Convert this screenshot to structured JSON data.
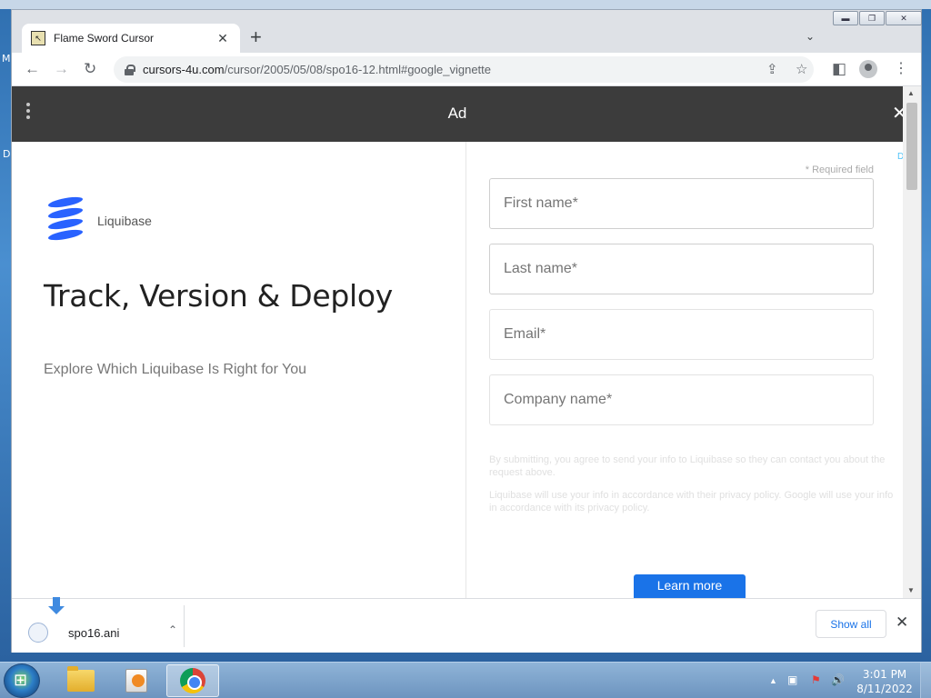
{
  "desktop": {
    "label_m": "M",
    "label_d": "D"
  },
  "tab": {
    "title": "Flame Sword Cursor",
    "close_glyph": "✕",
    "new_tab_glyph": "+"
  },
  "window_controls": {
    "minimize": "▬",
    "maximize": "❐",
    "close": "✕"
  },
  "toolbar": {
    "url_host": "cursors-4u.com",
    "url_path": "/cursor/2005/05/08/spo16-12.html#google_vignette",
    "back": "←",
    "forward": "→",
    "reload": "↻",
    "share": "⇪",
    "bookmark": "☆",
    "sidepanel": "◧",
    "menu": "⋮",
    "tab_search": "⌄"
  },
  "ad": {
    "bar_title": "Ad",
    "close_glyph": "✕",
    "brand": "Liquibase",
    "headline": "Track, Version & Deploy",
    "subhead": "Explore Which Liquibase Is Right for You",
    "required_note": "* Required field",
    "fields": {
      "first_name": "First name*",
      "last_name": "Last name*",
      "email": "Email*",
      "company": "Company name*"
    },
    "disclaimer_1": "By submitting, you agree to send your info to Liquibase so they can contact you about the request above.",
    "disclaimer_2": "Liquibase will use your info in accordance with their privacy policy. Google will use your info in accordance with its privacy policy.",
    "cta": "Learn more"
  },
  "scrollbar": {
    "up": "▲",
    "down": "▼"
  },
  "downloads": {
    "file_name": "spo16.ani",
    "chevron": "⌃",
    "show_all": "Show all",
    "close_glyph": "✕"
  },
  "taskbar": {
    "time": "3:01 PM",
    "date": "8/11/2022",
    "tray_arrow": "▲",
    "tray_network": "▣",
    "tray_flag": "⚑",
    "tray_volume": "🔊"
  },
  "colors": {
    "ad_bar": "#3c3c3c",
    "brand_blue": "#2962ff",
    "cta_blue": "#1a73e8",
    "chrome_titlebar": "#dee1e6"
  }
}
